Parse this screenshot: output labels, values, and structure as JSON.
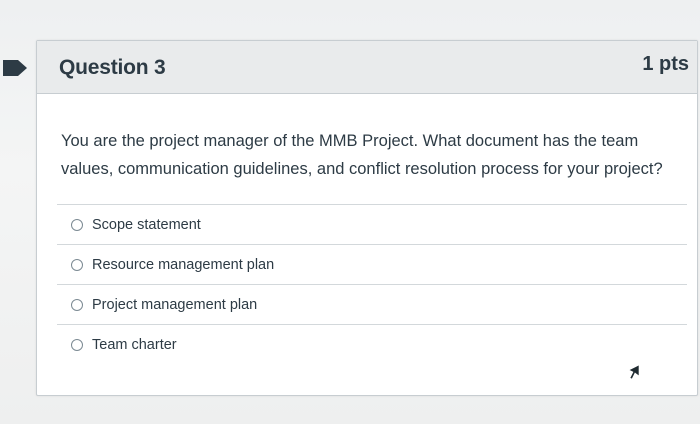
{
  "question": {
    "title": "Question 3",
    "points": "1 pts",
    "text": "You are the project manager of the MMB Project. What document has the team values, communication guidelines, and conflict resolution process for your project?",
    "answers": [
      {
        "label": "Scope statement",
        "selected": false
      },
      {
        "label": "Resource management plan",
        "selected": false
      },
      {
        "label": "Project management plan",
        "selected": false
      },
      {
        "label": "Team charter",
        "selected": false
      }
    ]
  },
  "icons": {
    "marker": "flag-marker-icon",
    "cursor": "mouse-pointer-icon"
  },
  "colors": {
    "text": "#2d3b45",
    "header_bg": "#e9ebec",
    "marker": "#2d3b45"
  }
}
